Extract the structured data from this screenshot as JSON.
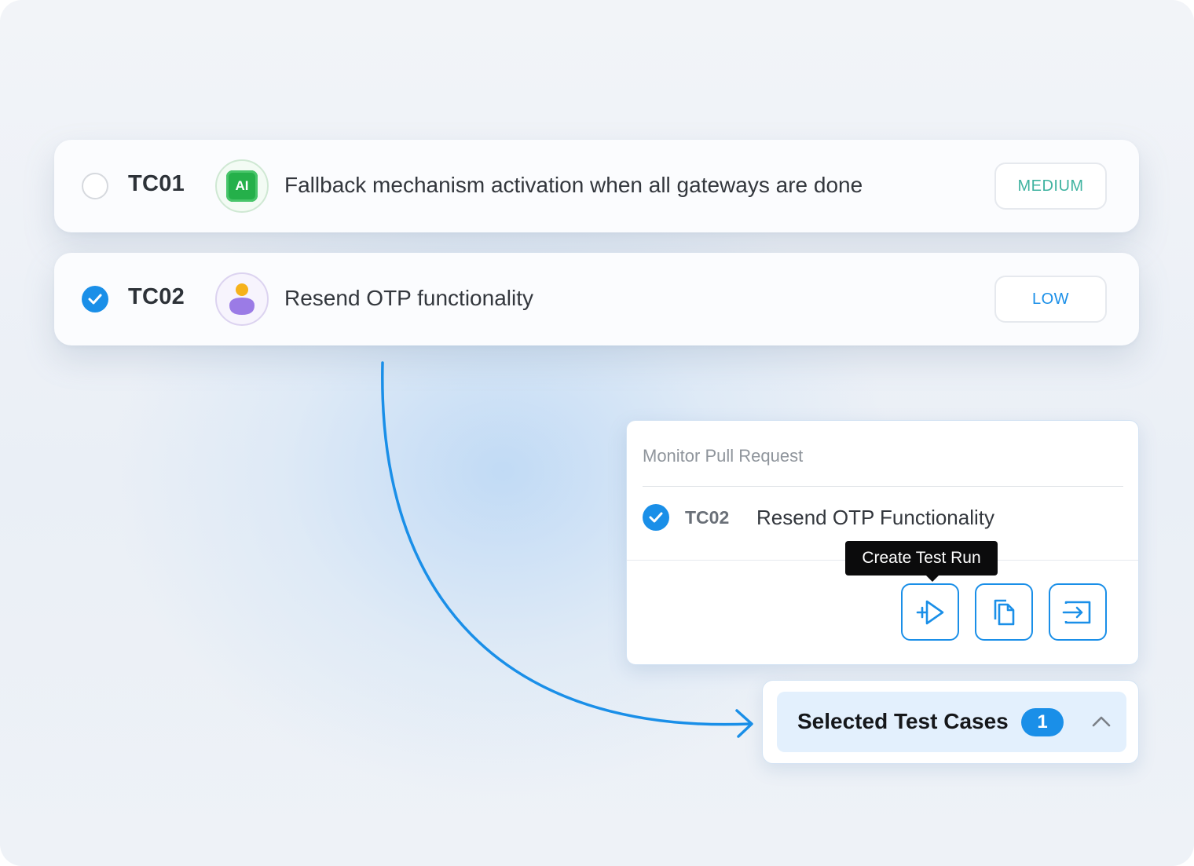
{
  "test_cases": [
    {
      "id": "TC01",
      "title": "Fallback mechanism activation when all gateways are done",
      "priority": "MEDIUM",
      "priority_color": "#3fb3a0",
      "selected": false,
      "avatar": "ai-icon",
      "avatar_text": "AI"
    },
    {
      "id": "TC02",
      "title": "Resend OTP functionality",
      "priority": "LOW",
      "priority_color": "#1a8fe8",
      "selected": true,
      "avatar": "user-icon"
    }
  ],
  "panel": {
    "title": "Monitor Pull Request",
    "item": {
      "id": "TC02",
      "name": "Resend OTP Functionality"
    },
    "tooltip": "Create Test Run",
    "actions": [
      {
        "name": "create-test-run",
        "icon": "play-plus-icon"
      },
      {
        "name": "copy",
        "icon": "copy-icon"
      },
      {
        "name": "move",
        "icon": "move-in-icon"
      }
    ]
  },
  "selected_bar": {
    "label": "Selected Test Cases",
    "count": "1",
    "icon": "chevron-up-icon"
  },
  "colors": {
    "accent": "#1a8fe8"
  }
}
